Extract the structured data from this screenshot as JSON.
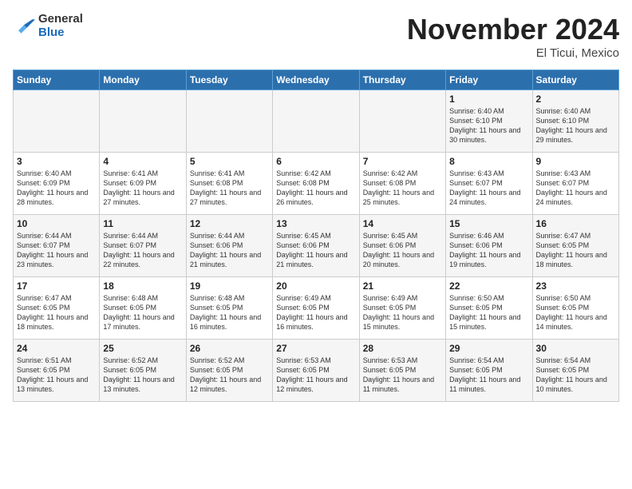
{
  "logo": {
    "general": "General",
    "blue": "Blue"
  },
  "calendar": {
    "title": "November 2024",
    "subtitle": "El Ticui, Mexico"
  },
  "weekdays": [
    "Sunday",
    "Monday",
    "Tuesday",
    "Wednesday",
    "Thursday",
    "Friday",
    "Saturday"
  ],
  "weeks": [
    [
      {
        "day": "",
        "info": ""
      },
      {
        "day": "",
        "info": ""
      },
      {
        "day": "",
        "info": ""
      },
      {
        "day": "",
        "info": ""
      },
      {
        "day": "",
        "info": ""
      },
      {
        "day": "1",
        "info": "Sunrise: 6:40 AM\nSunset: 6:10 PM\nDaylight: 11 hours and 30 minutes."
      },
      {
        "day": "2",
        "info": "Sunrise: 6:40 AM\nSunset: 6:10 PM\nDaylight: 11 hours and 29 minutes."
      }
    ],
    [
      {
        "day": "3",
        "info": "Sunrise: 6:40 AM\nSunset: 6:09 PM\nDaylight: 11 hours and 28 minutes."
      },
      {
        "day": "4",
        "info": "Sunrise: 6:41 AM\nSunset: 6:09 PM\nDaylight: 11 hours and 27 minutes."
      },
      {
        "day": "5",
        "info": "Sunrise: 6:41 AM\nSunset: 6:08 PM\nDaylight: 11 hours and 27 minutes."
      },
      {
        "day": "6",
        "info": "Sunrise: 6:42 AM\nSunset: 6:08 PM\nDaylight: 11 hours and 26 minutes."
      },
      {
        "day": "7",
        "info": "Sunrise: 6:42 AM\nSunset: 6:08 PM\nDaylight: 11 hours and 25 minutes."
      },
      {
        "day": "8",
        "info": "Sunrise: 6:43 AM\nSunset: 6:07 PM\nDaylight: 11 hours and 24 minutes."
      },
      {
        "day": "9",
        "info": "Sunrise: 6:43 AM\nSunset: 6:07 PM\nDaylight: 11 hours and 24 minutes."
      }
    ],
    [
      {
        "day": "10",
        "info": "Sunrise: 6:44 AM\nSunset: 6:07 PM\nDaylight: 11 hours and 23 minutes."
      },
      {
        "day": "11",
        "info": "Sunrise: 6:44 AM\nSunset: 6:07 PM\nDaylight: 11 hours and 22 minutes."
      },
      {
        "day": "12",
        "info": "Sunrise: 6:44 AM\nSunset: 6:06 PM\nDaylight: 11 hours and 21 minutes."
      },
      {
        "day": "13",
        "info": "Sunrise: 6:45 AM\nSunset: 6:06 PM\nDaylight: 11 hours and 21 minutes."
      },
      {
        "day": "14",
        "info": "Sunrise: 6:45 AM\nSunset: 6:06 PM\nDaylight: 11 hours and 20 minutes."
      },
      {
        "day": "15",
        "info": "Sunrise: 6:46 AM\nSunset: 6:06 PM\nDaylight: 11 hours and 19 minutes."
      },
      {
        "day": "16",
        "info": "Sunrise: 6:47 AM\nSunset: 6:05 PM\nDaylight: 11 hours and 18 minutes."
      }
    ],
    [
      {
        "day": "17",
        "info": "Sunrise: 6:47 AM\nSunset: 6:05 PM\nDaylight: 11 hours and 18 minutes."
      },
      {
        "day": "18",
        "info": "Sunrise: 6:48 AM\nSunset: 6:05 PM\nDaylight: 11 hours and 17 minutes."
      },
      {
        "day": "19",
        "info": "Sunrise: 6:48 AM\nSunset: 6:05 PM\nDaylight: 11 hours and 16 minutes."
      },
      {
        "day": "20",
        "info": "Sunrise: 6:49 AM\nSunset: 6:05 PM\nDaylight: 11 hours and 16 minutes."
      },
      {
        "day": "21",
        "info": "Sunrise: 6:49 AM\nSunset: 6:05 PM\nDaylight: 11 hours and 15 minutes."
      },
      {
        "day": "22",
        "info": "Sunrise: 6:50 AM\nSunset: 6:05 PM\nDaylight: 11 hours and 15 minutes."
      },
      {
        "day": "23",
        "info": "Sunrise: 6:50 AM\nSunset: 6:05 PM\nDaylight: 11 hours and 14 minutes."
      }
    ],
    [
      {
        "day": "24",
        "info": "Sunrise: 6:51 AM\nSunset: 6:05 PM\nDaylight: 11 hours and 13 minutes."
      },
      {
        "day": "25",
        "info": "Sunrise: 6:52 AM\nSunset: 6:05 PM\nDaylight: 11 hours and 13 minutes."
      },
      {
        "day": "26",
        "info": "Sunrise: 6:52 AM\nSunset: 6:05 PM\nDaylight: 11 hours and 12 minutes."
      },
      {
        "day": "27",
        "info": "Sunrise: 6:53 AM\nSunset: 6:05 PM\nDaylight: 11 hours and 12 minutes."
      },
      {
        "day": "28",
        "info": "Sunrise: 6:53 AM\nSunset: 6:05 PM\nDaylight: 11 hours and 11 minutes."
      },
      {
        "day": "29",
        "info": "Sunrise: 6:54 AM\nSunset: 6:05 PM\nDaylight: 11 hours and 11 minutes."
      },
      {
        "day": "30",
        "info": "Sunrise: 6:54 AM\nSunset: 6:05 PM\nDaylight: 11 hours and 10 minutes."
      }
    ]
  ]
}
